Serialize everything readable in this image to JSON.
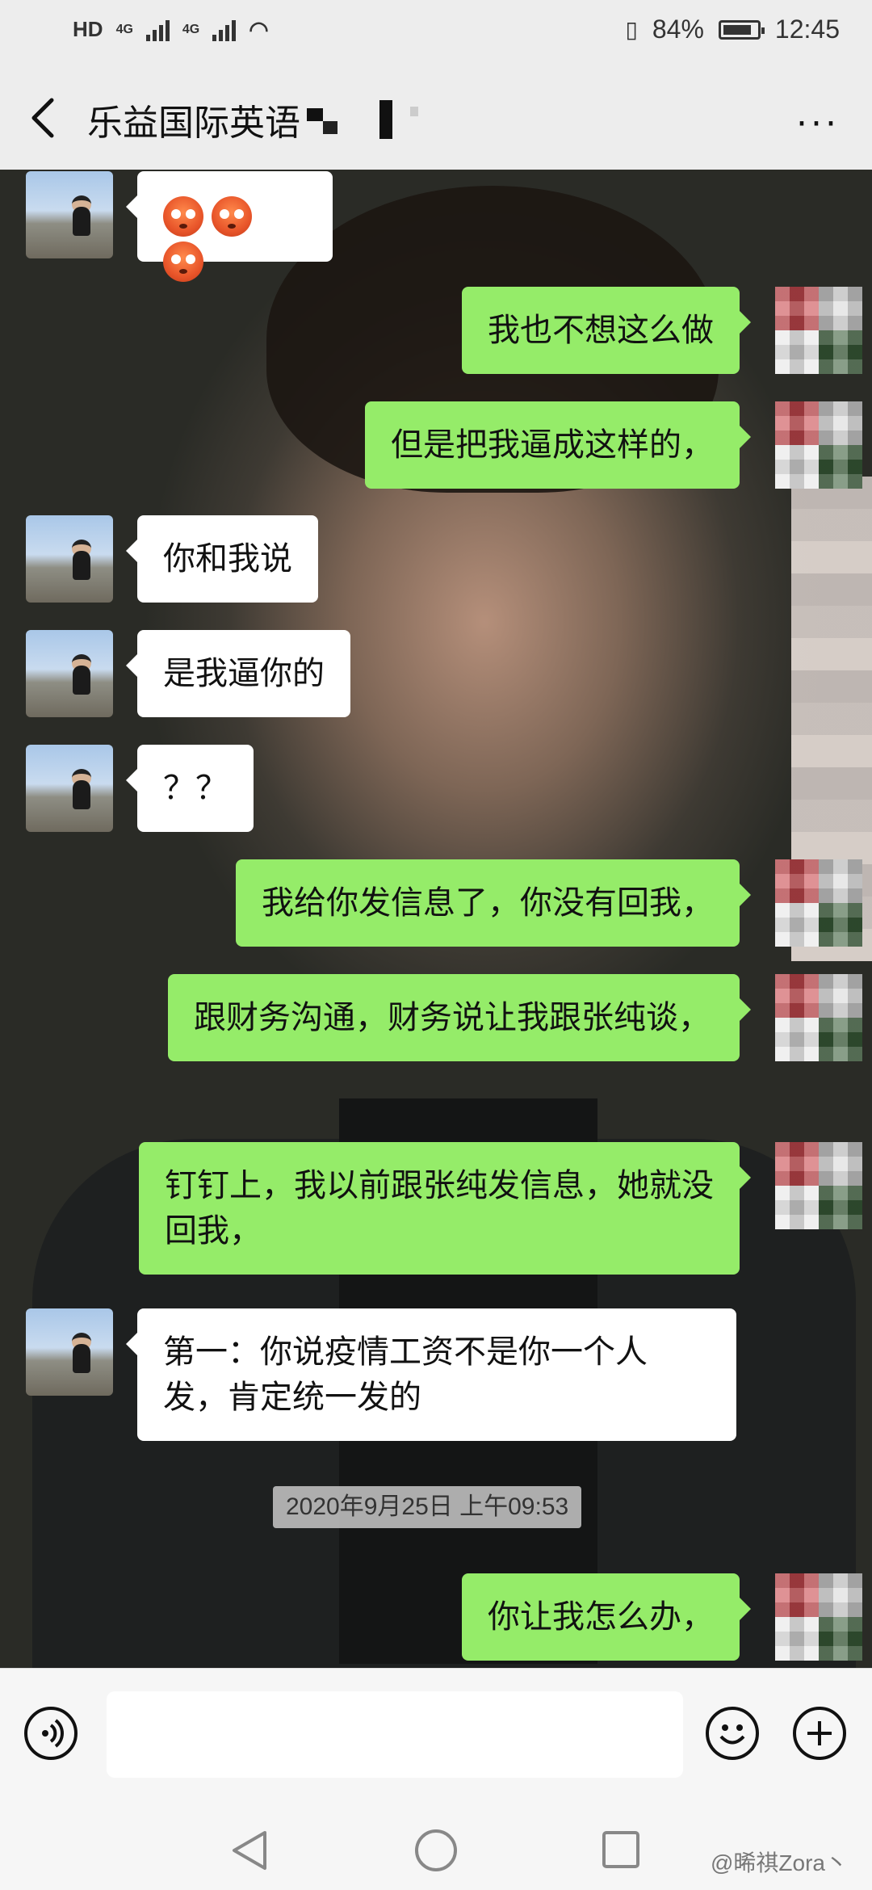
{
  "status_bar": {
    "network_left": "HD",
    "sim1": "4G",
    "sim2": "4G",
    "battery_percent": "84%",
    "battery_level": 0.84,
    "time": "12:45"
  },
  "header": {
    "title": "乐益国际英语",
    "more_label": "···"
  },
  "messages": [
    {
      "side": "in",
      "type": "emoji",
      "emoji_count": 3,
      "emoji_name": "flushed-face-icon"
    },
    {
      "side": "out",
      "text": "我也不想这么做"
    },
    {
      "side": "out",
      "text": "但是把我逼成这样的，"
    },
    {
      "side": "in",
      "text": "你和我说"
    },
    {
      "side": "in",
      "text": "是我逼你的"
    },
    {
      "side": "in",
      "text": "？？"
    },
    {
      "side": "out",
      "text": "我给你发信息了，你没有回我，"
    },
    {
      "side": "out",
      "text": "跟财务沟通，财务说让我跟张纯谈，"
    },
    {
      "side": "out",
      "text": "钉钉上，我以前跟张纯发信息，她就没回我，"
    },
    {
      "side": "in",
      "text": "第一：你说疫情工资不是你一个人发，肯定统一发的"
    },
    {
      "side": "out",
      "text": "你让我怎么办，"
    }
  ],
  "timestamp": "2020年9月25日 上午09:53",
  "input_bar": {
    "voice_icon": "voice-icon",
    "emoji_icon": "emoji-icon",
    "plus_icon": "plus-icon",
    "text_value": ""
  },
  "nav_bar": {
    "back": "back-triangle-icon",
    "home": "home-circle-icon",
    "recent": "recent-square-icon"
  },
  "watermark": "@晞祺Zora丶"
}
